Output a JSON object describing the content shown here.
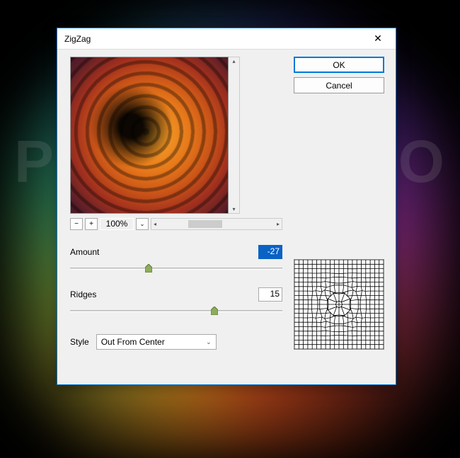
{
  "watermark": "PSD-DUDE.CO",
  "dialog": {
    "title": "ZigZag",
    "buttons": {
      "ok": "OK",
      "cancel": "Cancel"
    },
    "zoom": {
      "value": "100%"
    },
    "amount": {
      "label": "Amount",
      "value": "-27",
      "pos_pct": 37
    },
    "ridges": {
      "label": "Ridges",
      "value": "15",
      "pos_pct": 68
    },
    "style": {
      "label": "Style",
      "value": "Out From Center"
    }
  }
}
